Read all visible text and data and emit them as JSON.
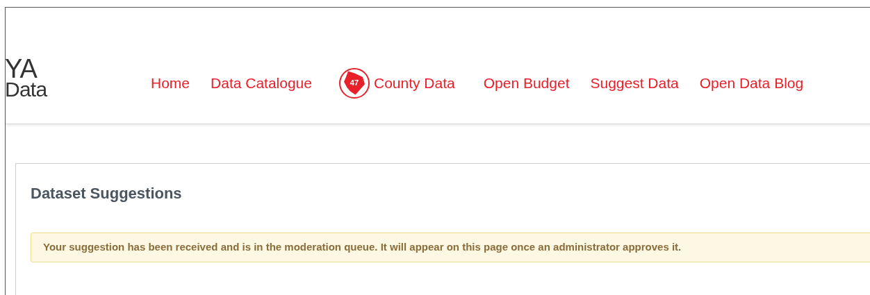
{
  "logo": {
    "line_1": "YA",
    "line_2": "Data"
  },
  "nav": [
    {
      "label": "Home",
      "kind": "link"
    },
    {
      "label": "Data Catalogue",
      "kind": "link"
    },
    {
      "label": "County Data",
      "kind": "county",
      "badge": "47"
    },
    {
      "label": "Open Budget",
      "kind": "link"
    },
    {
      "label": "Suggest Data",
      "kind": "link"
    },
    {
      "label": "Open Data Blog",
      "kind": "link"
    }
  ],
  "panel": {
    "title": "Dataset Suggestions",
    "alert": "Your suggestion has been received and is in the moderation queue. It will appear on this page once an administrator approves it."
  }
}
